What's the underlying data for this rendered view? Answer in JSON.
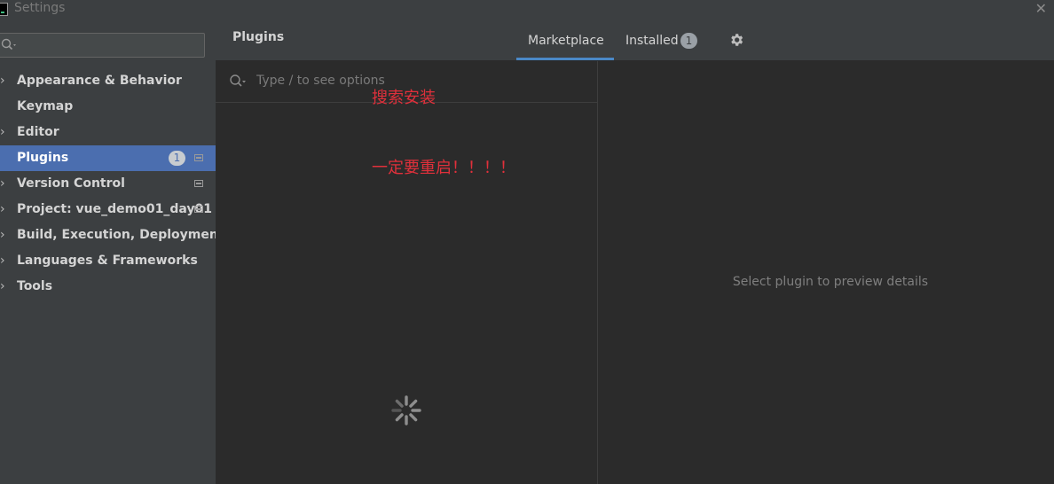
{
  "window": {
    "title": "Settings",
    "close_glyph": "✕"
  },
  "sidebar": {
    "search": {
      "value": "",
      "placeholder": ""
    },
    "items": [
      {
        "label": "Appearance & Behavior",
        "expandable": true
      },
      {
        "label": "Keymap",
        "expandable": false
      },
      {
        "label": "Editor",
        "expandable": true
      },
      {
        "label": "Plugins",
        "expandable": false,
        "selected": true,
        "badge": "1",
        "project_icon": true
      },
      {
        "label": "Version Control",
        "expandable": true,
        "project_icon": true
      },
      {
        "label": "Project: vue_demo01_day01",
        "expandable": true,
        "project_icon": true
      },
      {
        "label": "Build, Execution, Deployment",
        "expandable": true
      },
      {
        "label": "Languages & Frameworks",
        "expandable": true
      },
      {
        "label": "Tools",
        "expandable": true
      }
    ]
  },
  "header": {
    "title": "Plugins",
    "tabs": [
      {
        "label": "Marketplace",
        "active": true
      },
      {
        "label": "Installed",
        "badge": "1",
        "active": false
      }
    ],
    "settings_icon": "gear-icon"
  },
  "plugin_list": {
    "search": {
      "value": "",
      "placeholder": "Type / to see options"
    },
    "loading_icon": "spinner-icon"
  },
  "annotations": [
    "搜索安装",
    "一定要重启！！！！"
  ],
  "details": {
    "empty_text": "Select plugin to preview details"
  },
  "colors": {
    "selection": "#4b6eaf",
    "tab_underline": "#4a88c7",
    "annotation": "#e0303b",
    "sidebar_bg": "#3c3f41",
    "content_bg": "#2b2b2b"
  }
}
